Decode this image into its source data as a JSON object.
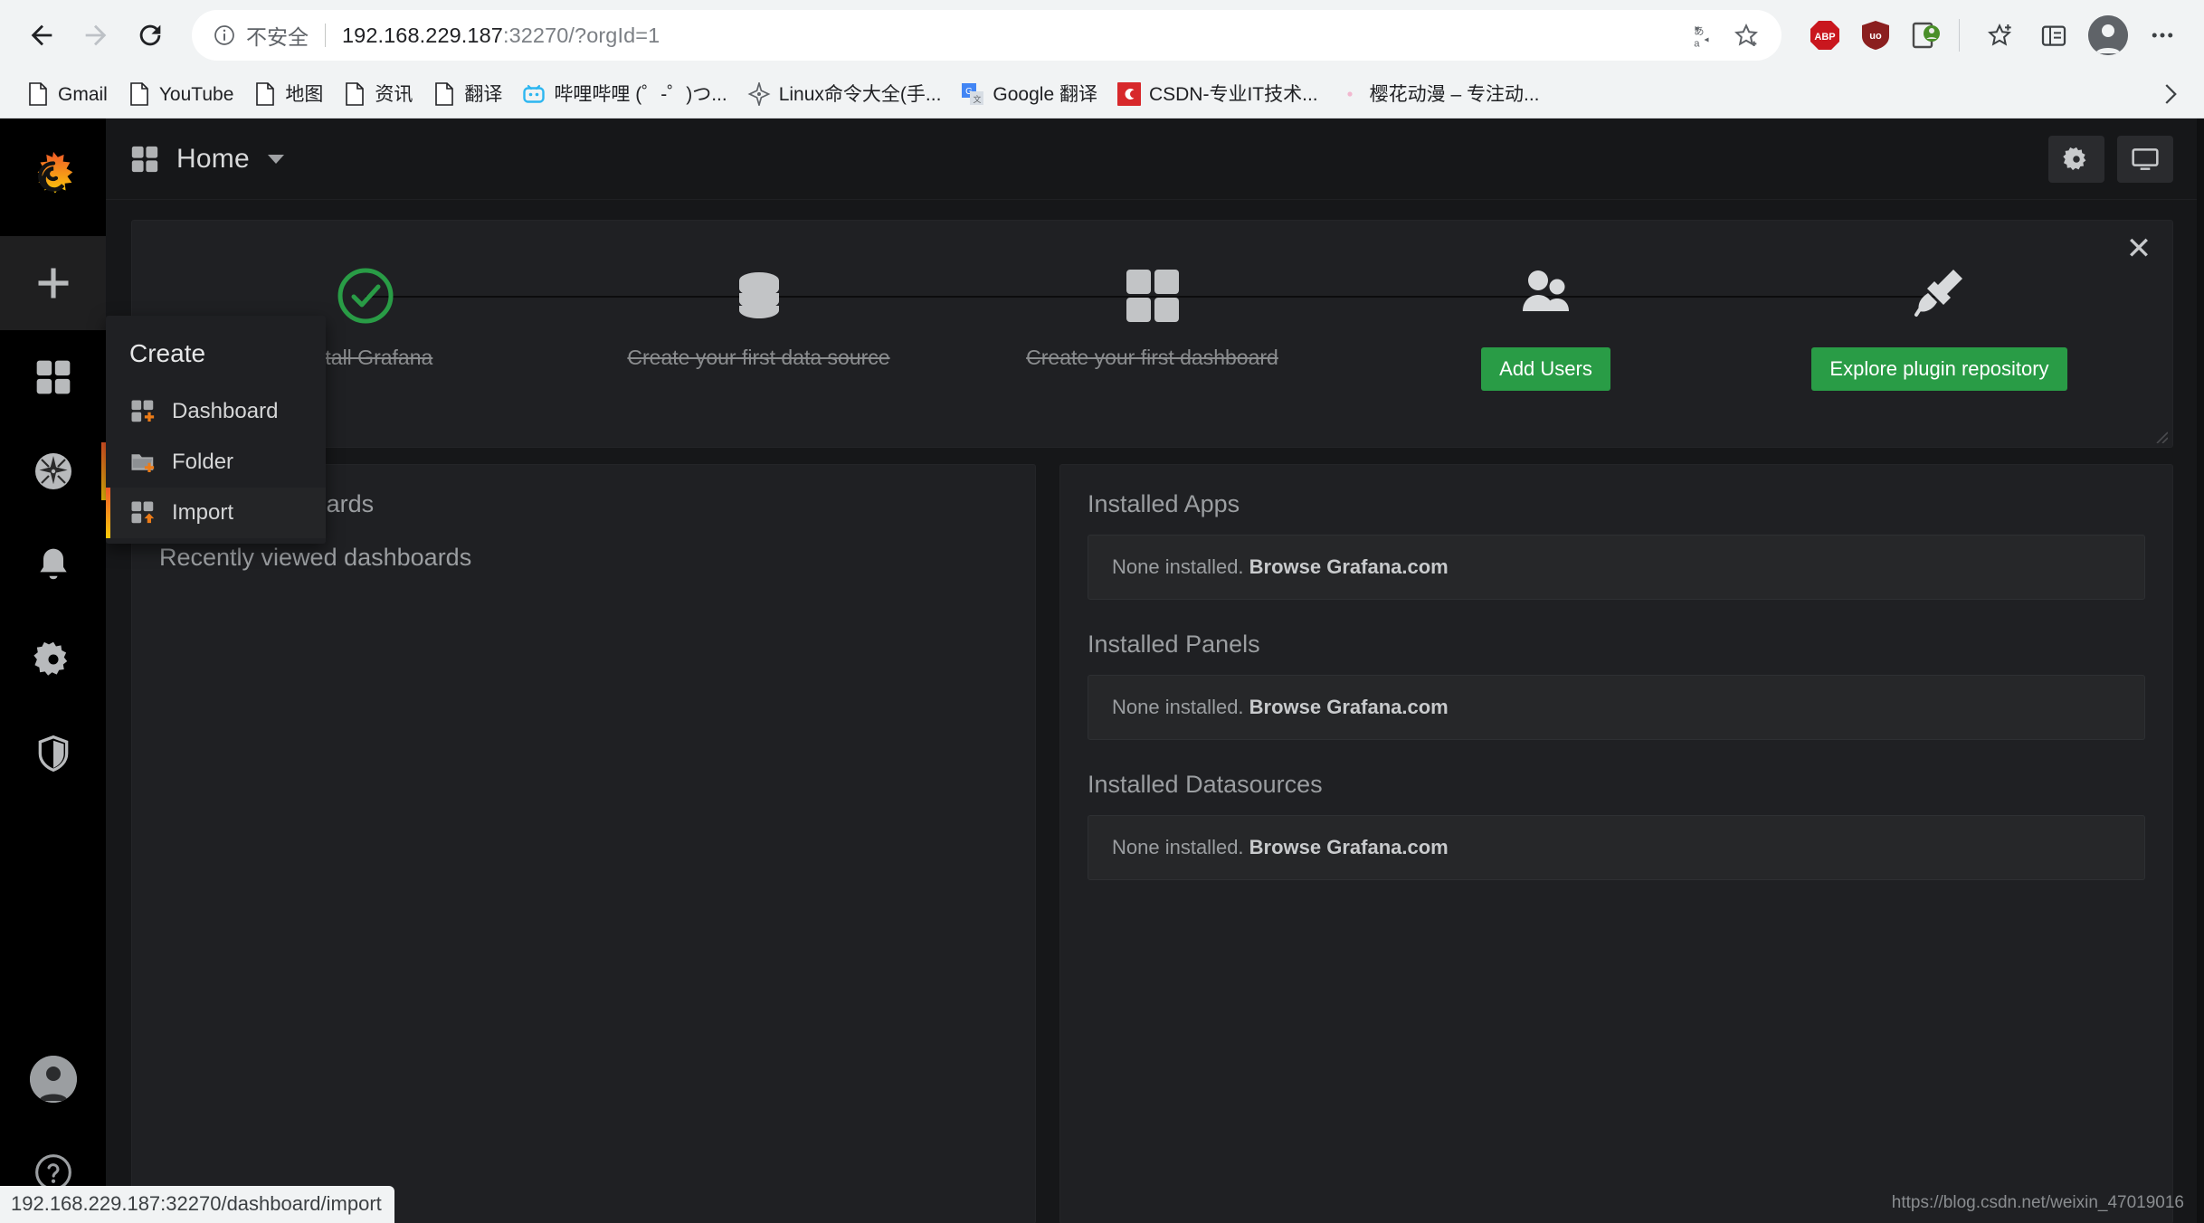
{
  "browser": {
    "back_label": "Back",
    "forward_label": "Forward",
    "reload_label": "Reload",
    "security_text": "不安全",
    "url_host": "192.168.229.187",
    "url_rest": ":32270/?orgId=1",
    "translate_icon": "translate-icon",
    "bookmark_star_icon": "star-icon",
    "extensions": [
      {
        "name": "adblock-plus",
        "label": "ABP",
        "color": "#c9171e"
      },
      {
        "name": "ublock-origin",
        "label": "uo",
        "color": "#8b1f1f"
      },
      {
        "name": "tampermonkey",
        "label": "",
        "color": "#4a8f29"
      }
    ],
    "collections_icon": "collections-icon",
    "favorites_icon": "favorites-icon",
    "profile_icon": "profile-avatar",
    "menu_icon": "more-options-icon",
    "bookmarks": [
      {
        "label": "Gmail",
        "icon": "page-icon"
      },
      {
        "label": "YouTube",
        "icon": "page-icon"
      },
      {
        "label": "地图",
        "icon": "page-icon"
      },
      {
        "label": "资讯",
        "icon": "page-icon"
      },
      {
        "label": "翻译",
        "icon": "page-icon"
      },
      {
        "label": "哔哩哔哩 (゜-゜)つ...",
        "icon": "bilibili-icon"
      },
      {
        "label": "Linux命令大全(手...",
        "icon": "compass-icon"
      },
      {
        "label": "Google 翻译",
        "icon": "google-translate-icon"
      },
      {
        "label": "CSDN-专业IT技术...",
        "icon": "csdn-icon"
      },
      {
        "label": "樱花动漫 – 专注动...",
        "icon": "sakura-icon"
      }
    ],
    "overflow_label": "More bookmarks",
    "status_link": "192.168.229.187:32270/dashboard/import"
  },
  "grafana": {
    "logo_name": "grafana-logo",
    "breadcrumb": {
      "icon": "dashboards-icon",
      "title": "Home"
    },
    "topnav_buttons": [
      {
        "name": "settings-button",
        "icon": "gear-icon"
      },
      {
        "name": "tv-mode-button",
        "icon": "monitor-icon"
      }
    ],
    "sidebar": [
      {
        "name": "create-button",
        "icon": "plus-icon",
        "label": "Create"
      },
      {
        "name": "dashboards-nav",
        "icon": "dashboards-icon",
        "label": "Dashboards"
      },
      {
        "name": "explore-nav",
        "icon": "compass-icon",
        "label": "Explore"
      },
      {
        "name": "alerting-nav",
        "icon": "bell-icon",
        "label": "Alerting"
      },
      {
        "name": "configuration-nav",
        "icon": "gear-icon",
        "label": "Configuration"
      },
      {
        "name": "server-admin-nav",
        "icon": "shield-icon",
        "label": "Server Admin"
      }
    ],
    "sidebar_bottom": [
      {
        "name": "user-profile",
        "icon": "user-avatar",
        "label": "Profile"
      },
      {
        "name": "help-button",
        "icon": "question-icon",
        "label": "Help"
      }
    ],
    "create_menu": {
      "header": "Create",
      "items": [
        {
          "label": "Dashboard",
          "icon": "dashboard-add-icon",
          "selected": false
        },
        {
          "label": "Folder",
          "icon": "folder-add-icon",
          "selected": false
        },
        {
          "label": "Import",
          "icon": "import-icon",
          "selected": true
        }
      ]
    },
    "onboarding": {
      "close_label": "×",
      "steps": [
        {
          "label": "Install Grafana",
          "icon": "check-circle-icon",
          "done": true,
          "button": null
        },
        {
          "label": "Create your first data source",
          "icon": "database-icon",
          "done": true,
          "button": null
        },
        {
          "label": "Create your first dashboard",
          "icon": "dashboard-icon",
          "done": true,
          "button": null
        },
        {
          "label": "",
          "icon": "users-icon",
          "done": false,
          "button": "Add Users"
        },
        {
          "label": "",
          "icon": "plugin-icon",
          "done": false,
          "button": "Explore plugin repository"
        }
      ],
      "button_color": "#299c46"
    },
    "left_panel": {
      "starred_title": "Starred dashboards",
      "recent_title": "Recently viewed dashboards"
    },
    "right_panel": {
      "sections": [
        {
          "title": "Installed Apps",
          "none_text": "None installed. ",
          "link_text": "Browse Grafana.com"
        },
        {
          "title": "Installed Panels",
          "none_text": "None installed. ",
          "link_text": "Browse Grafana.com"
        },
        {
          "title": "Installed Datasources",
          "none_text": "None installed. ",
          "link_text": "Browse Grafana.com"
        }
      ]
    },
    "watermark": "https://blog.csdn.net/weixin_47019016"
  }
}
